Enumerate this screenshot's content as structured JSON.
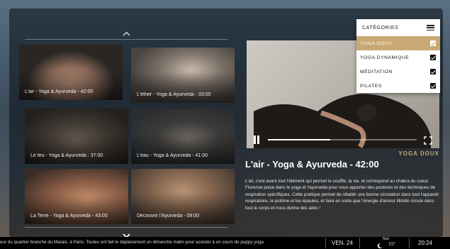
{
  "tiles": [
    {
      "label": "L'air - Yoga & Ayurveda - 42:00",
      "selected": true
    },
    {
      "label": "L'éther - Yoga & Ayurveda - 33:00",
      "selected": false
    },
    {
      "label": "Le feu - Yoga & Ayurveda : 37:00",
      "selected": false
    },
    {
      "label": "L'eau - Yoga & Ayurveda - 41:00",
      "selected": false
    },
    {
      "label": "La Terre - Yoga & Ayurveda - 43:00",
      "selected": false
    },
    {
      "label": "Découvrir l'Ayurveda - 09:00",
      "selected": false
    }
  ],
  "menu": {
    "title": "CATÉGORIES",
    "items": [
      {
        "label": "YOGA DOUX",
        "checked": true,
        "active": true
      },
      {
        "label": "YOGA DYNAMIQUE",
        "checked": true,
        "active": false
      },
      {
        "label": "MÉDITATION",
        "checked": true,
        "active": false
      },
      {
        "label": "PILATES",
        "checked": true,
        "active": false
      }
    ]
  },
  "player": {
    "progress_fraction": 0.42
  },
  "detail": {
    "category": "YOGA DOUX",
    "title": "L'air - Yoga & Ayurveda - 42:00",
    "description": "L'air, c'est avant tout l'élément qui permet le souffle, la vie, et correspond au chakra du coeur. Florence puise dans le yoga et l'ayurveda pour vous apporter des postures et des techniques de respiration spécifiques. Cette pratique permet de rétablir une bonne circulation dans tout l'appareil respiratoire, la poitrine et les épaules, et faire en sorte que l'énergie d'amour illimité circule dans tout le corps et nous donne des ailes !"
  },
  "bottombar": {
    "ticker": "eur du quartier branché du Marais, à Paris. Toutes ont fait le déplacement un dimanche matin pour assister à un cours de puppy yoga",
    "date": "VEN. 24",
    "weather_label": "Nuit",
    "temperature": "15°",
    "time": "20:24"
  },
  "colors": {
    "accent": "#c9a874",
    "overlay": "#080e14"
  },
  "icons": {
    "up": "chevron-up-icon",
    "down": "chevron-down-icon",
    "menu": "hamburger-icon",
    "pause": "pause-icon",
    "fullscreen": "fullscreen-icon",
    "weather": "moon-icon"
  }
}
